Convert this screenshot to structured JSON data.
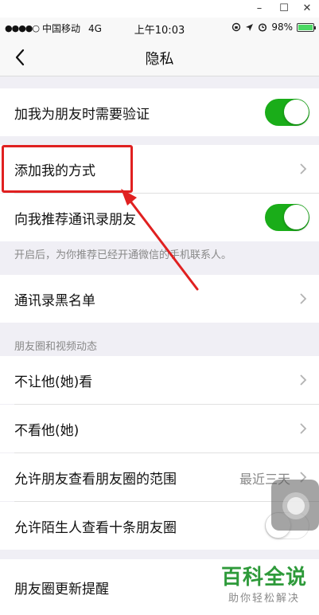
{
  "window_controls": {
    "minimize": "–",
    "maximize": "☐",
    "close": "✕"
  },
  "status_bar": {
    "signal": "●●●●○",
    "carrier": "中国移动",
    "network": "4G",
    "time": "上午10:03",
    "battery": "98%",
    "battery_level": 0.98
  },
  "nav": {
    "title": "隐私"
  },
  "rows": {
    "verify": {
      "label": "加我为朋友时需要验证",
      "toggle": true
    },
    "add_method": {
      "label": "添加我的方式"
    },
    "recommend_contacts": {
      "label": "向我推荐通讯录朋友",
      "toggle": true
    },
    "recommend_note": "开启后，为你推荐已经开通微信的手机联系人。",
    "blacklist": {
      "label": "通讯录黑名单"
    },
    "moments_section": "朋友圈和视频动态",
    "hide_from": {
      "label": "不让他(她)看"
    },
    "hide_them": {
      "label": "不看他(她)"
    },
    "moments_range": {
      "label": "允许朋友查看朋友圈的范围",
      "value": "最近三天"
    },
    "stranger_ten": {
      "label": "允许陌生人查看十条朋友圈",
      "toggle": false
    },
    "moments_update": {
      "label": "朋友圈更新提醒"
    }
  },
  "watermark": {
    "main": "百科全说",
    "sub": "助你轻松解决"
  },
  "colors": {
    "toggle_on": "#1aad19",
    "annotation": "#e02020",
    "watermark": "#2e9a3a"
  }
}
